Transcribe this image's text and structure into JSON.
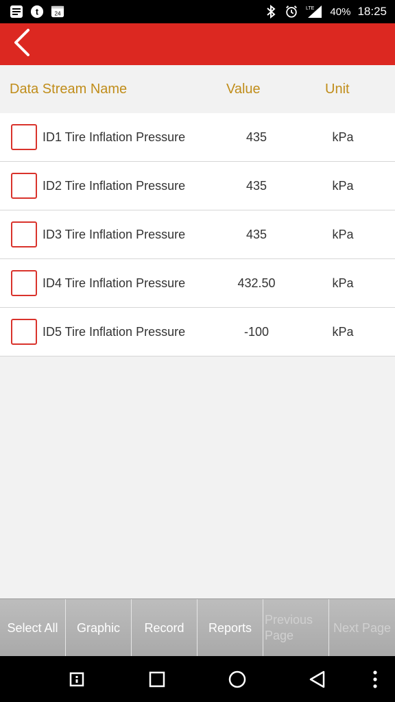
{
  "status_bar": {
    "battery": "40%",
    "time": "18:25",
    "network": "LTE",
    "left_icons": [
      "notes-icon",
      "tumblr-icon",
      "calendar-24-icon"
    ],
    "calendar_day": "24"
  },
  "app_bar": {
    "back_icon": "chevron-left-icon",
    "background_color": "#dc2821"
  },
  "table": {
    "headers": {
      "name": "Data Stream Name",
      "value": "Value",
      "unit": "Unit"
    },
    "header_color": "#c08d1a",
    "rows": [
      {
        "name": "ID1 Tire Inflation Pressure",
        "value": "435",
        "unit": "kPa",
        "checked": false
      },
      {
        "name": "ID2 Tire Inflation Pressure",
        "value": "435",
        "unit": "kPa",
        "checked": false
      },
      {
        "name": "ID3 Tire Inflation Pressure",
        "value": "435",
        "unit": "kPa",
        "checked": false
      },
      {
        "name": "ID4 Tire Inflation Pressure",
        "value": "432.50",
        "unit": "kPa",
        "checked": false
      },
      {
        "name": "ID5 Tire Inflation Pressure",
        "value": "-100",
        "unit": "kPa",
        "checked": false
      }
    ]
  },
  "toolbar": {
    "select_all": "Select All",
    "graphic": "Graphic",
    "record": "Record",
    "reports": "Reports",
    "previous_page": "Previous Page",
    "next_page": "Next Page"
  },
  "nav_bar": {
    "items": [
      "menu-icon",
      "recents-icon",
      "home-icon",
      "back-icon",
      "overflow-icon"
    ]
  }
}
